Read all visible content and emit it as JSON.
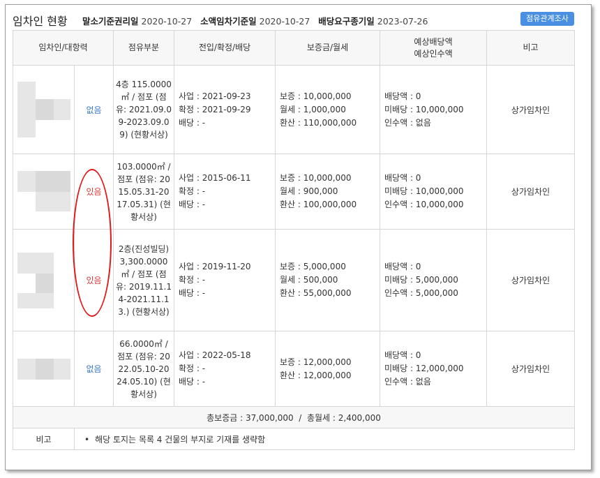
{
  "header": {
    "title": "임차인 현황",
    "malso_label": "말소기준권리일",
    "malso_date": "2020-10-27",
    "soaek_label": "소액임차기준일",
    "soaek_date": "2020-10-27",
    "baedang_label": "배당요구종기일",
    "baedang_date": "2023-07-26",
    "survey_button": "점유관계조사"
  },
  "columns": {
    "tenant": "임차인/대항력",
    "occupancy": "점유부분",
    "dates": "전입/확정/배당",
    "deposit": "보증금/월세",
    "expected_line1": "예상배당액",
    "expected_line2": "예상인수액",
    "note": "비고"
  },
  "rows": [
    {
      "opposability": "없음",
      "occupancy": "4층 115.0000㎡ / 점포 (점유: 2021.09.09-2023.09.09) (현황서상)",
      "moved_in": "사업 : 2021-09-23",
      "confirmed": "확정 : 2021-09-29",
      "dividend": "배당 : -",
      "deposit": "보증 : 10,000,000",
      "monthly": "월세 : 1,000,000",
      "converted": "환산 : 110,000,000",
      "exp_dividend": "배당액 : 0",
      "exp_unpaid": "미배당 : 10,000,000",
      "exp_assume": "인수액 : 없음",
      "note": "상가임차인"
    },
    {
      "opposability": "있음",
      "occupancy": "103.0000㎡ / 점포 (점유: 2015.05.31-2017.05.31) (현황서상)",
      "moved_in": "사업 : 2015-06-11",
      "confirmed": "확정 : -",
      "dividend": "배당 : -",
      "deposit": "보증 : 10,000,000",
      "monthly": "월세 : 900,000",
      "converted": "환산 : 100,000,000",
      "exp_dividend": "배당액 : 0",
      "exp_unpaid": "미배당 : 10,000,000",
      "exp_assume": "인수액 : 10,000,000",
      "note": "상가임차인"
    },
    {
      "opposability": "있음",
      "occupancy": "2층(진성빌딩) 3,300.0000㎡ / 점포 (점유: 2019.11.14-2021.11.13.) (현황서상)",
      "moved_in": "사업 : 2019-11-20",
      "confirmed": "확정 : -",
      "dividend": "배당 : -",
      "deposit": "보증 : 5,000,000",
      "monthly": "월세 : 500,000",
      "converted": "환산 : 55,000,000",
      "exp_dividend": "배당액 : 0",
      "exp_unpaid": "미배당 : 5,000,000",
      "exp_assume": "인수액 : 5,000,000",
      "note": "상가임차인"
    },
    {
      "opposability": "없음",
      "occupancy": "66.0000㎡ / 점포 (점유: 2022.05.10-2024.05.10) (현황서상)",
      "moved_in": "사업 : 2022-05-18",
      "confirmed": "확정 : -",
      "dividend": "배당 : -",
      "deposit": "보증 : 12,000,000",
      "monthly": "",
      "converted": "환산 : 12,000,000",
      "exp_dividend": "배당액 : 0",
      "exp_unpaid": "미배당 : 12,000,000",
      "exp_assume": "인수액 : 없음",
      "note": "상가임차인"
    }
  ],
  "totals": {
    "text": "총보증금 : 37,000,000  /  총월세 : 2,400,000"
  },
  "remarks": {
    "label": "비고",
    "text": "해당 토지는 목록 4 건물의 부지로 기재를 생략함"
  }
}
